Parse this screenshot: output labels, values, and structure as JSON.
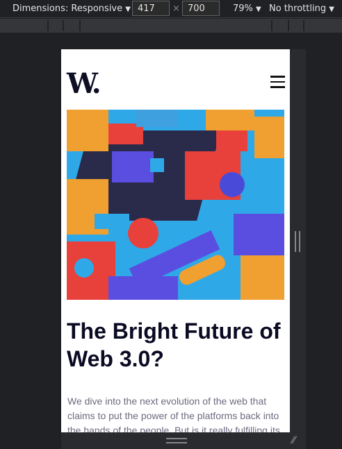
{
  "devtools": {
    "dimensions_label": "Dimensions: Responsive",
    "width": "417",
    "times": "×",
    "height": "700",
    "zoom": "79%",
    "throttling": "No throttling",
    "caret": "▼"
  },
  "site": {
    "logo": "W.",
    "title": "The Bright Future of Web 3.0?",
    "excerpt": "We dive into the next evolution of the web that claims to put the power of the platforms back into the hands of the people. But is it really fulfilling its promise?"
  },
  "icons": {
    "menu": "hamburger-icon",
    "hero": "colorful-3d-blocks-illustration"
  }
}
